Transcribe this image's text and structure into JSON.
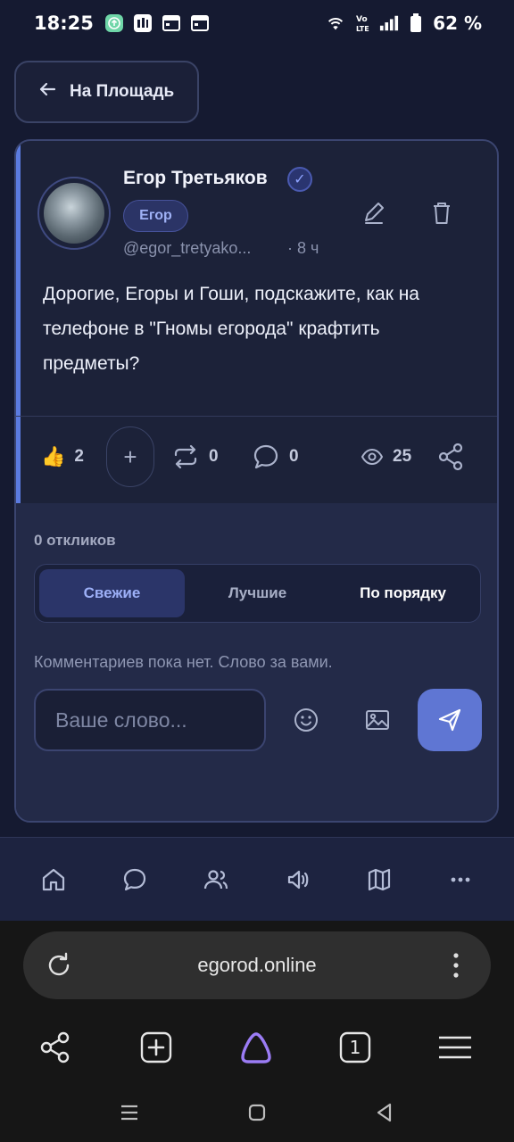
{
  "status_bar": {
    "time": "18:25",
    "battery": "62 %",
    "icons": [
      "upload-icon",
      "app-icon",
      "calendar-icon",
      "calendar-icon",
      "wifi-icon",
      "volte-icon",
      "signal-icon",
      "battery-icon"
    ]
  },
  "nav": {
    "back_label": "На Площадь"
  },
  "post": {
    "author": "Егор Третьяков",
    "tag": "Егор",
    "handle": "@egor_tretyako...",
    "time_ago": "· 8 ч",
    "text": "Дорогие, Егоры и Гоши, подскажите, как на телефоне в \"Гномы егорода\" крафтить предметы?",
    "likes": "2",
    "reposts": "0",
    "comments": "0",
    "views": "25"
  },
  "comments": {
    "count_label": "0 откликов",
    "tabs": [
      "Свежие",
      "Лучшие",
      "По порядку"
    ],
    "empty_text": "Комментариев пока нет. Слово за вами.",
    "input_placeholder": "Ваше слово..."
  },
  "browser": {
    "url": "egorod.online",
    "tab_count": "1"
  },
  "colors": {
    "accent": "#5f76d3",
    "background": "#151a31",
    "card": "#1c2239"
  }
}
